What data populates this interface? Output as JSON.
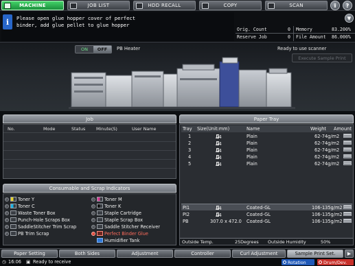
{
  "tabs": {
    "machine": "MACHINE",
    "job_list": "JOB LIST",
    "hdd_recall": "HDD RECALL",
    "copy": "COPY",
    "scan": "SCAN"
  },
  "top_icons": [
    "info-icon",
    "question-icon",
    "scroll-down-icon"
  ],
  "message": "Please open glue hopper cover of perfect\nbinder, add glue pellet to glue hopper",
  "counters": {
    "orig_count_label": "Orig. Count",
    "orig_count_value": "0",
    "memory_label": "Memory",
    "memory_value": "83.200%",
    "reserve_job_label": "Reserve Job",
    "reserve_job_value": "0",
    "file_amount_label": "File Amount",
    "file_amount_value": "86.000%"
  },
  "machine": {
    "toggle_on": "ON",
    "toggle_off": "OFF",
    "toggle_state": "OFF",
    "pb_heater": "PB Heater",
    "ready_scanner": "Ready to use scanner",
    "sample_print": "Execute Sample Print"
  },
  "job": {
    "title": "Job",
    "columns": [
      "No.",
      "Mode",
      "Status",
      "Minute(S)",
      "User Name"
    ]
  },
  "consumables": {
    "title": "Consumable and Scrap Indicators",
    "left": [
      {
        "label": "Toner Y",
        "icon": "toner-y-icon"
      },
      {
        "label": "Toner C",
        "icon": "toner-c-icon"
      },
      {
        "label": "Waste Toner Box",
        "icon": "waste-toner-box-icon"
      },
      {
        "label": "Punch-Hole Scraps Box",
        "icon": "punch-hole-box-icon"
      },
      {
        "label": "SaddleStitcher Trim Scrap",
        "icon": "trim-scrap-icon"
      },
      {
        "label": "PB Trim Scrap",
        "icon": "pb-trim-scrap-icon"
      }
    ],
    "right": [
      {
        "label": "Toner M",
        "icon": "toner-m-icon"
      },
      {
        "label": "Toner K",
        "icon": "toner-k-icon"
      },
      {
        "label": "Staple Cartridge",
        "icon": "staple-cartridge-icon"
      },
      {
        "label": "Staple Scrap Box",
        "icon": "staple-scrap-box-icon"
      },
      {
        "label": "Saddle Stitcher Receiver",
        "icon": "saddle-receiver-icon"
      },
      {
        "label": "Perfect Binder Glue",
        "icon": "glue-icon",
        "alert": true
      },
      {
        "label": "Humidifier Tank",
        "icon": "humidifier-tank-icon"
      }
    ]
  },
  "paper_tray": {
    "title": "Paper Tray",
    "columns": {
      "tray": "Tray",
      "size": "Size(Unit:mm)",
      "name": "Name",
      "weight": "Weight",
      "amount": "Amount"
    },
    "trays": [
      {
        "tray": "1",
        "size": "A4",
        "name": "Plain",
        "weight": "62-74g/m2"
      },
      {
        "tray": "2",
        "size": "A4",
        "name": "Plain",
        "weight": "62-74g/m2"
      },
      {
        "tray": "3",
        "size": "A4",
        "name": "Plain",
        "weight": "62-74g/m2"
      },
      {
        "tray": "4",
        "size": "A4",
        "name": "Plain",
        "weight": "62-74g/m2"
      },
      {
        "tray": "5",
        "size": "A4",
        "name": "Plain",
        "weight": "62-74g/m2"
      }
    ],
    "special_trays": [
      {
        "tray": "PI1",
        "size": "A4",
        "name": "Coated-GL",
        "weight": "106-135g/m2"
      },
      {
        "tray": "PI2",
        "size": "A4",
        "name": "Coated-GL",
        "weight": "106-135g/m2"
      },
      {
        "tray": "PB",
        "size": "307.0 x 472.0",
        "name": "Coated-GL",
        "weight": "106-135g/m2"
      }
    ],
    "outside_temp_label": "Outside Temp.",
    "outside_temp_value": "25Degrees",
    "outside_humidity_label": "Outside Humidity",
    "outside_humidity_value": "50%"
  },
  "function_bar": {
    "paper_setting": "Paper Setting",
    "both_sides": "Both Sides",
    "adjustment": "Adjustment",
    "controller": "Controller",
    "curl_adjustment": "Curl Adjustment",
    "sample_print_set": "Sample Print Set."
  },
  "status": {
    "time": "16:06",
    "message": "Ready to receive",
    "rotation": "Rotation",
    "drum_dev": "Drum/Dev.",
    "rotation_color": "#2059b8",
    "drum_color": "#c8302a"
  }
}
